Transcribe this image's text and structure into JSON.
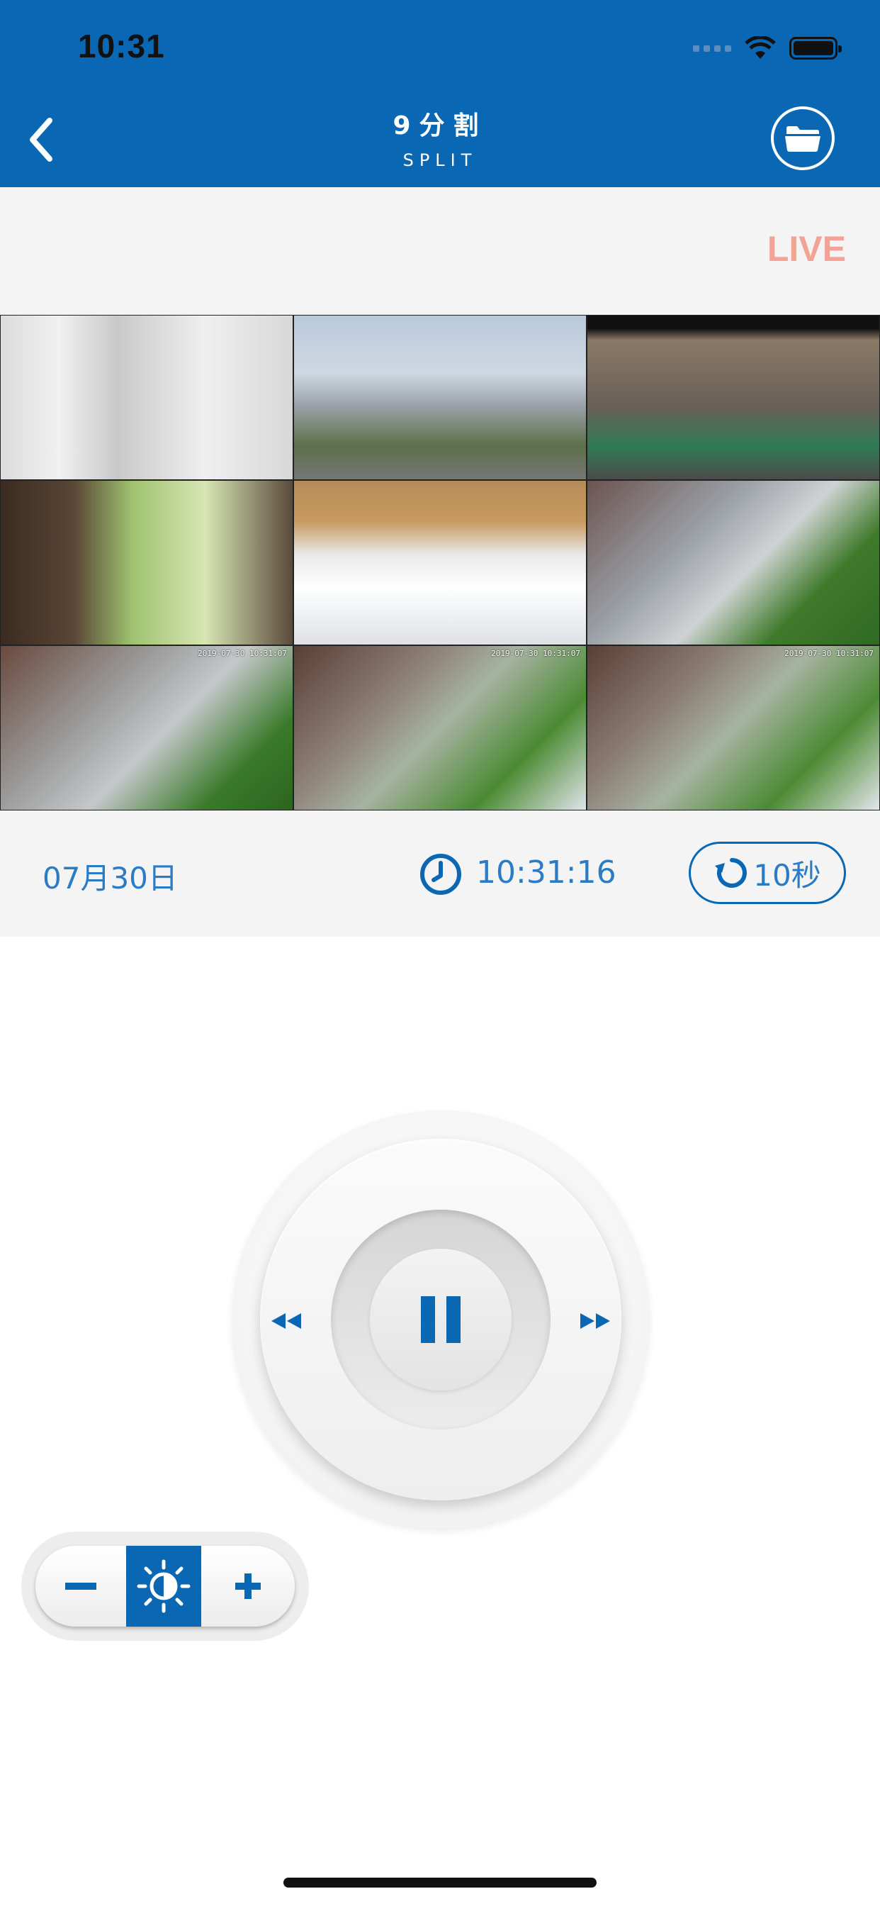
{
  "status_bar": {
    "time": "10:31"
  },
  "header": {
    "title": "9分割",
    "subtitle": "SPLIT"
  },
  "live_label": "LIVE",
  "cameras": [
    {
      "timestamp": ""
    },
    {
      "timestamp": ""
    },
    {
      "timestamp": ""
    },
    {
      "timestamp": ""
    },
    {
      "timestamp": ""
    },
    {
      "timestamp": ""
    },
    {
      "timestamp": "2019-07-30 10:31:07"
    },
    {
      "timestamp": "2019-07-30 10:31:07"
    },
    {
      "timestamp": "2019-07-30 10:31:07"
    }
  ],
  "info": {
    "date": "07月30日",
    "time": "10:31:16",
    "refresh_interval": "10秒"
  },
  "colors": {
    "brand": "#0a67b3",
    "text_accent": "#2b7cc4",
    "live": "#f3a394"
  },
  "icons": {
    "back": "chevron-left-icon",
    "folder": "folder-icon",
    "clock": "clock-icon",
    "refresh": "refresh-icon",
    "pause": "pause-icon",
    "rewind": "rewind-icon",
    "forward": "fast-forward-icon",
    "minus": "minus-icon",
    "brightness": "brightness-icon",
    "plus": "plus-icon"
  }
}
